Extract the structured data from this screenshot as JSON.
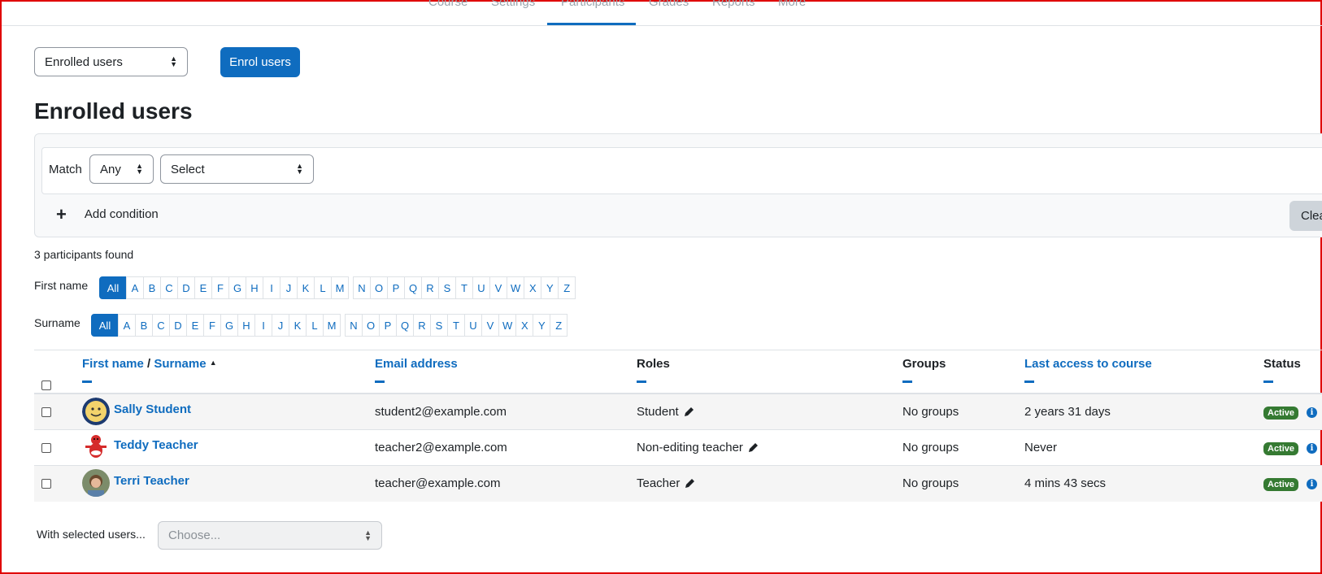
{
  "nav": {
    "tabs": [
      "Course",
      "Settings",
      "Participants",
      "Grades",
      "Reports",
      "More"
    ],
    "active": "Participants"
  },
  "page_select": {
    "value": "Enrolled users"
  },
  "enrol_button": "Enrol users",
  "title": "Enrolled users",
  "filter": {
    "match_label": "Match",
    "match_value": "Any",
    "type_value": "Select",
    "add_condition": "Add condition",
    "clear_label": "Clea"
  },
  "participants_found": "3 participants found",
  "initials": {
    "firstname_label": "First name",
    "surname_label": "Surname",
    "all_label": "All",
    "letters_a_m": [
      "A",
      "B",
      "C",
      "D",
      "E",
      "F",
      "G",
      "H",
      "I",
      "J",
      "K",
      "L",
      "M"
    ],
    "letters_n_z": [
      "N",
      "O",
      "P",
      "Q",
      "R",
      "S",
      "T",
      "U",
      "V",
      "W",
      "X",
      "Y",
      "Z"
    ]
  },
  "table": {
    "headers": {
      "firstname": "First name",
      "separator": "/",
      "surname": "Surname",
      "email": "Email address",
      "roles": "Roles",
      "groups": "Groups",
      "lastaccess": "Last access to course",
      "status": "Status"
    },
    "rows": [
      {
        "name": "Sally Student",
        "email": "student2@example.com",
        "role": "Student",
        "groups": "No groups",
        "lastaccess": "2 years 31 days",
        "status": "Active",
        "avatar": "smiley-avatar"
      },
      {
        "name": "Teddy Teacher",
        "email": "teacher2@example.com",
        "role": "Non-editing teacher",
        "groups": "No groups",
        "lastaccess": "Never",
        "status": "Active",
        "avatar": "teddy-avatar"
      },
      {
        "name": "Terri Teacher",
        "email": "teacher@example.com",
        "role": "Teacher",
        "groups": "No groups",
        "lastaccess": "4 mins 43 secs",
        "status": "Active",
        "avatar": "photo-avatar"
      }
    ]
  },
  "bulk": {
    "label": "With selected users...",
    "placeholder": "Choose..."
  },
  "colors": {
    "primary": "#0f6cbf",
    "active_badge": "#357a32",
    "frame": "#e00000"
  }
}
